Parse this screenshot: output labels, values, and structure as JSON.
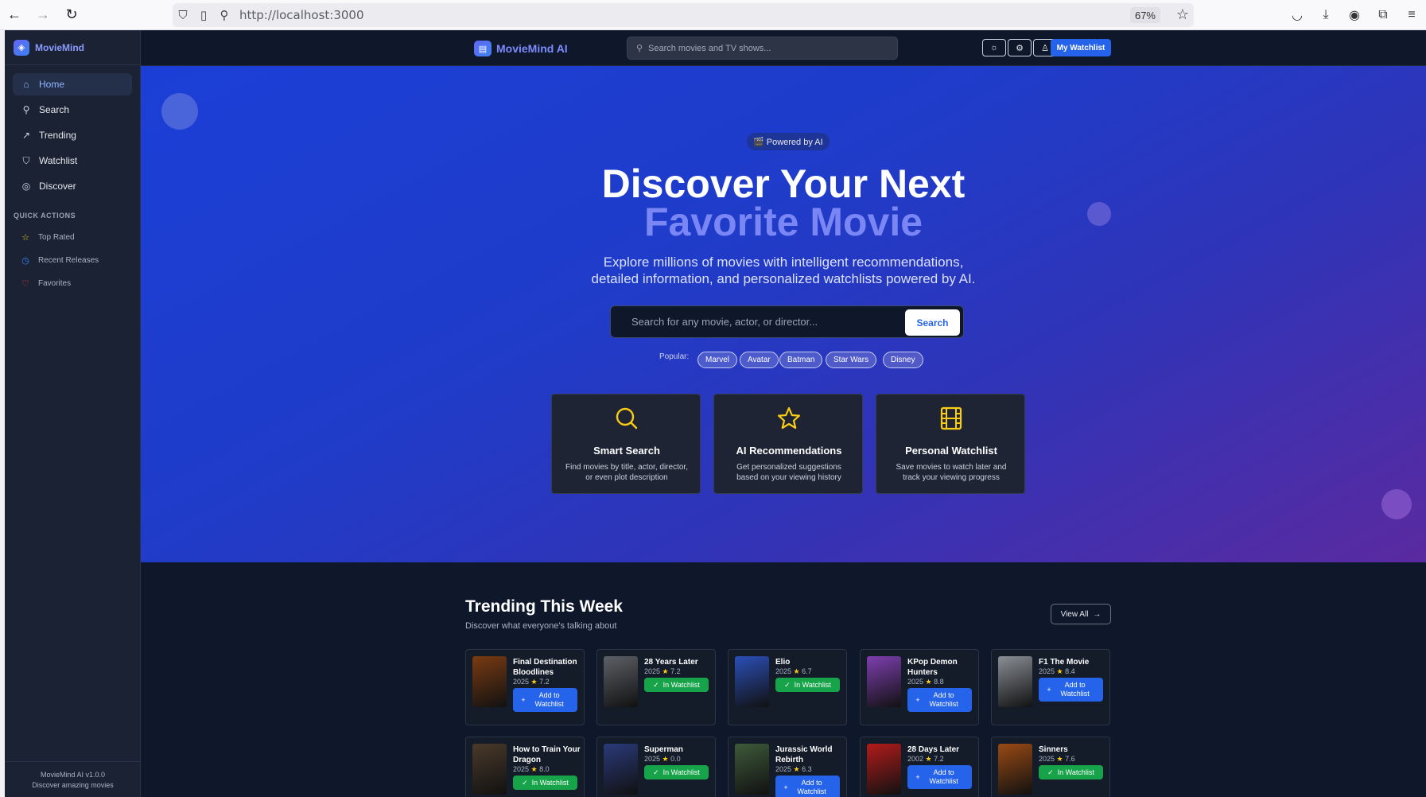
{
  "browser": {
    "url": "http://localhost:3000",
    "zoom": "67%"
  },
  "sidebar": {
    "brand": "MovieMind",
    "nav": [
      {
        "label": "Home",
        "icon": "home-icon",
        "active": true
      },
      {
        "label": "Search",
        "icon": "search-icon"
      },
      {
        "label": "Trending",
        "icon": "trending-icon"
      },
      {
        "label": "Watchlist",
        "icon": "bookmark-icon"
      },
      {
        "label": "Discover",
        "icon": "compass-icon"
      }
    ],
    "quick_actions_title": "QUICK ACTIONS",
    "quick_actions": [
      {
        "label": "Top Rated",
        "icon": "star-icon",
        "color": "#facc15"
      },
      {
        "label": "Recent Releases",
        "icon": "clock-icon",
        "color": "#3b82f6"
      },
      {
        "label": "Favorites",
        "icon": "heart-icon",
        "color": "#ef4444"
      }
    ],
    "footer_version": "MovieMind AI v1.0.0",
    "footer_tagline": "Discover amazing movies"
  },
  "header": {
    "brand": "MovieMind AI",
    "search_placeholder": "Search movies and TV shows...",
    "watchlist_label": "My Watchlist"
  },
  "hero": {
    "badge": "🎬 Powered by AI",
    "title_line1": "Discover Your Next",
    "title_line2": "Favorite Movie",
    "subtitle_line1": "Explore millions of movies with intelligent recommendations,",
    "subtitle_line2": "detailed information, and personalized watchlists powered by AI.",
    "search_placeholder": "Search for any movie, actor, or director...",
    "search_button": "Search",
    "popular_label": "Popular:",
    "popular": [
      "Marvel",
      "Avatar",
      "Batman",
      "Star Wars",
      "Disney"
    ],
    "features": [
      {
        "title": "Smart Search",
        "desc": "Find movies by title, actor, director, or even plot description",
        "icon": "search-icon"
      },
      {
        "title": "AI Recommendations",
        "desc": "Get personalized suggestions based on your viewing history",
        "icon": "star-icon"
      },
      {
        "title": "Personal Watchlist",
        "desc": "Save movies to watch later and track your viewing progress",
        "icon": "film-icon"
      }
    ]
  },
  "trending": {
    "title": "Trending This Week",
    "subtitle": "Discover what everyone's talking about",
    "view_all": "View All",
    "add_label": "Add to Watchlist",
    "in_label": "In Watchlist",
    "movies": [
      {
        "title": "Final Destination Bloodlines",
        "year": "2025",
        "rating": "7.2",
        "in_watchlist": false,
        "poster": "#7a3b12"
      },
      {
        "title": "28 Years Later",
        "year": "2025",
        "rating": "7.2",
        "in_watchlist": true,
        "poster": "#5d6066"
      },
      {
        "title": "Elio",
        "year": "2025",
        "rating": "6.7",
        "in_watchlist": true,
        "poster": "#2b4fb8"
      },
      {
        "title": "KPop Demon Hunters",
        "year": "2025",
        "rating": "8.8",
        "in_watchlist": false,
        "poster": "#7e3fb0"
      },
      {
        "title": "F1 The Movie",
        "year": "2025",
        "rating": "8.4",
        "in_watchlist": false,
        "poster": "#8a8f96"
      },
      {
        "title": "How to Train Your Dragon",
        "year": "2025",
        "rating": "8.0",
        "in_watchlist": true,
        "poster": "#4a3a2a"
      },
      {
        "title": "Superman",
        "year": "2025",
        "rating": "0.0",
        "in_watchlist": true,
        "poster": "#2a3a7a"
      },
      {
        "title": "Jurassic World Rebirth",
        "year": "2025",
        "rating": "6.3",
        "in_watchlist": false,
        "poster": "#3e5a3a"
      },
      {
        "title": "28 Days Later",
        "year": "2002",
        "rating": "7.2",
        "in_watchlist": false,
        "poster": "#b31b1b"
      },
      {
        "title": "Sinners",
        "year": "2025",
        "rating": "7.6",
        "in_watchlist": true,
        "poster": "#9a4a14"
      }
    ]
  }
}
